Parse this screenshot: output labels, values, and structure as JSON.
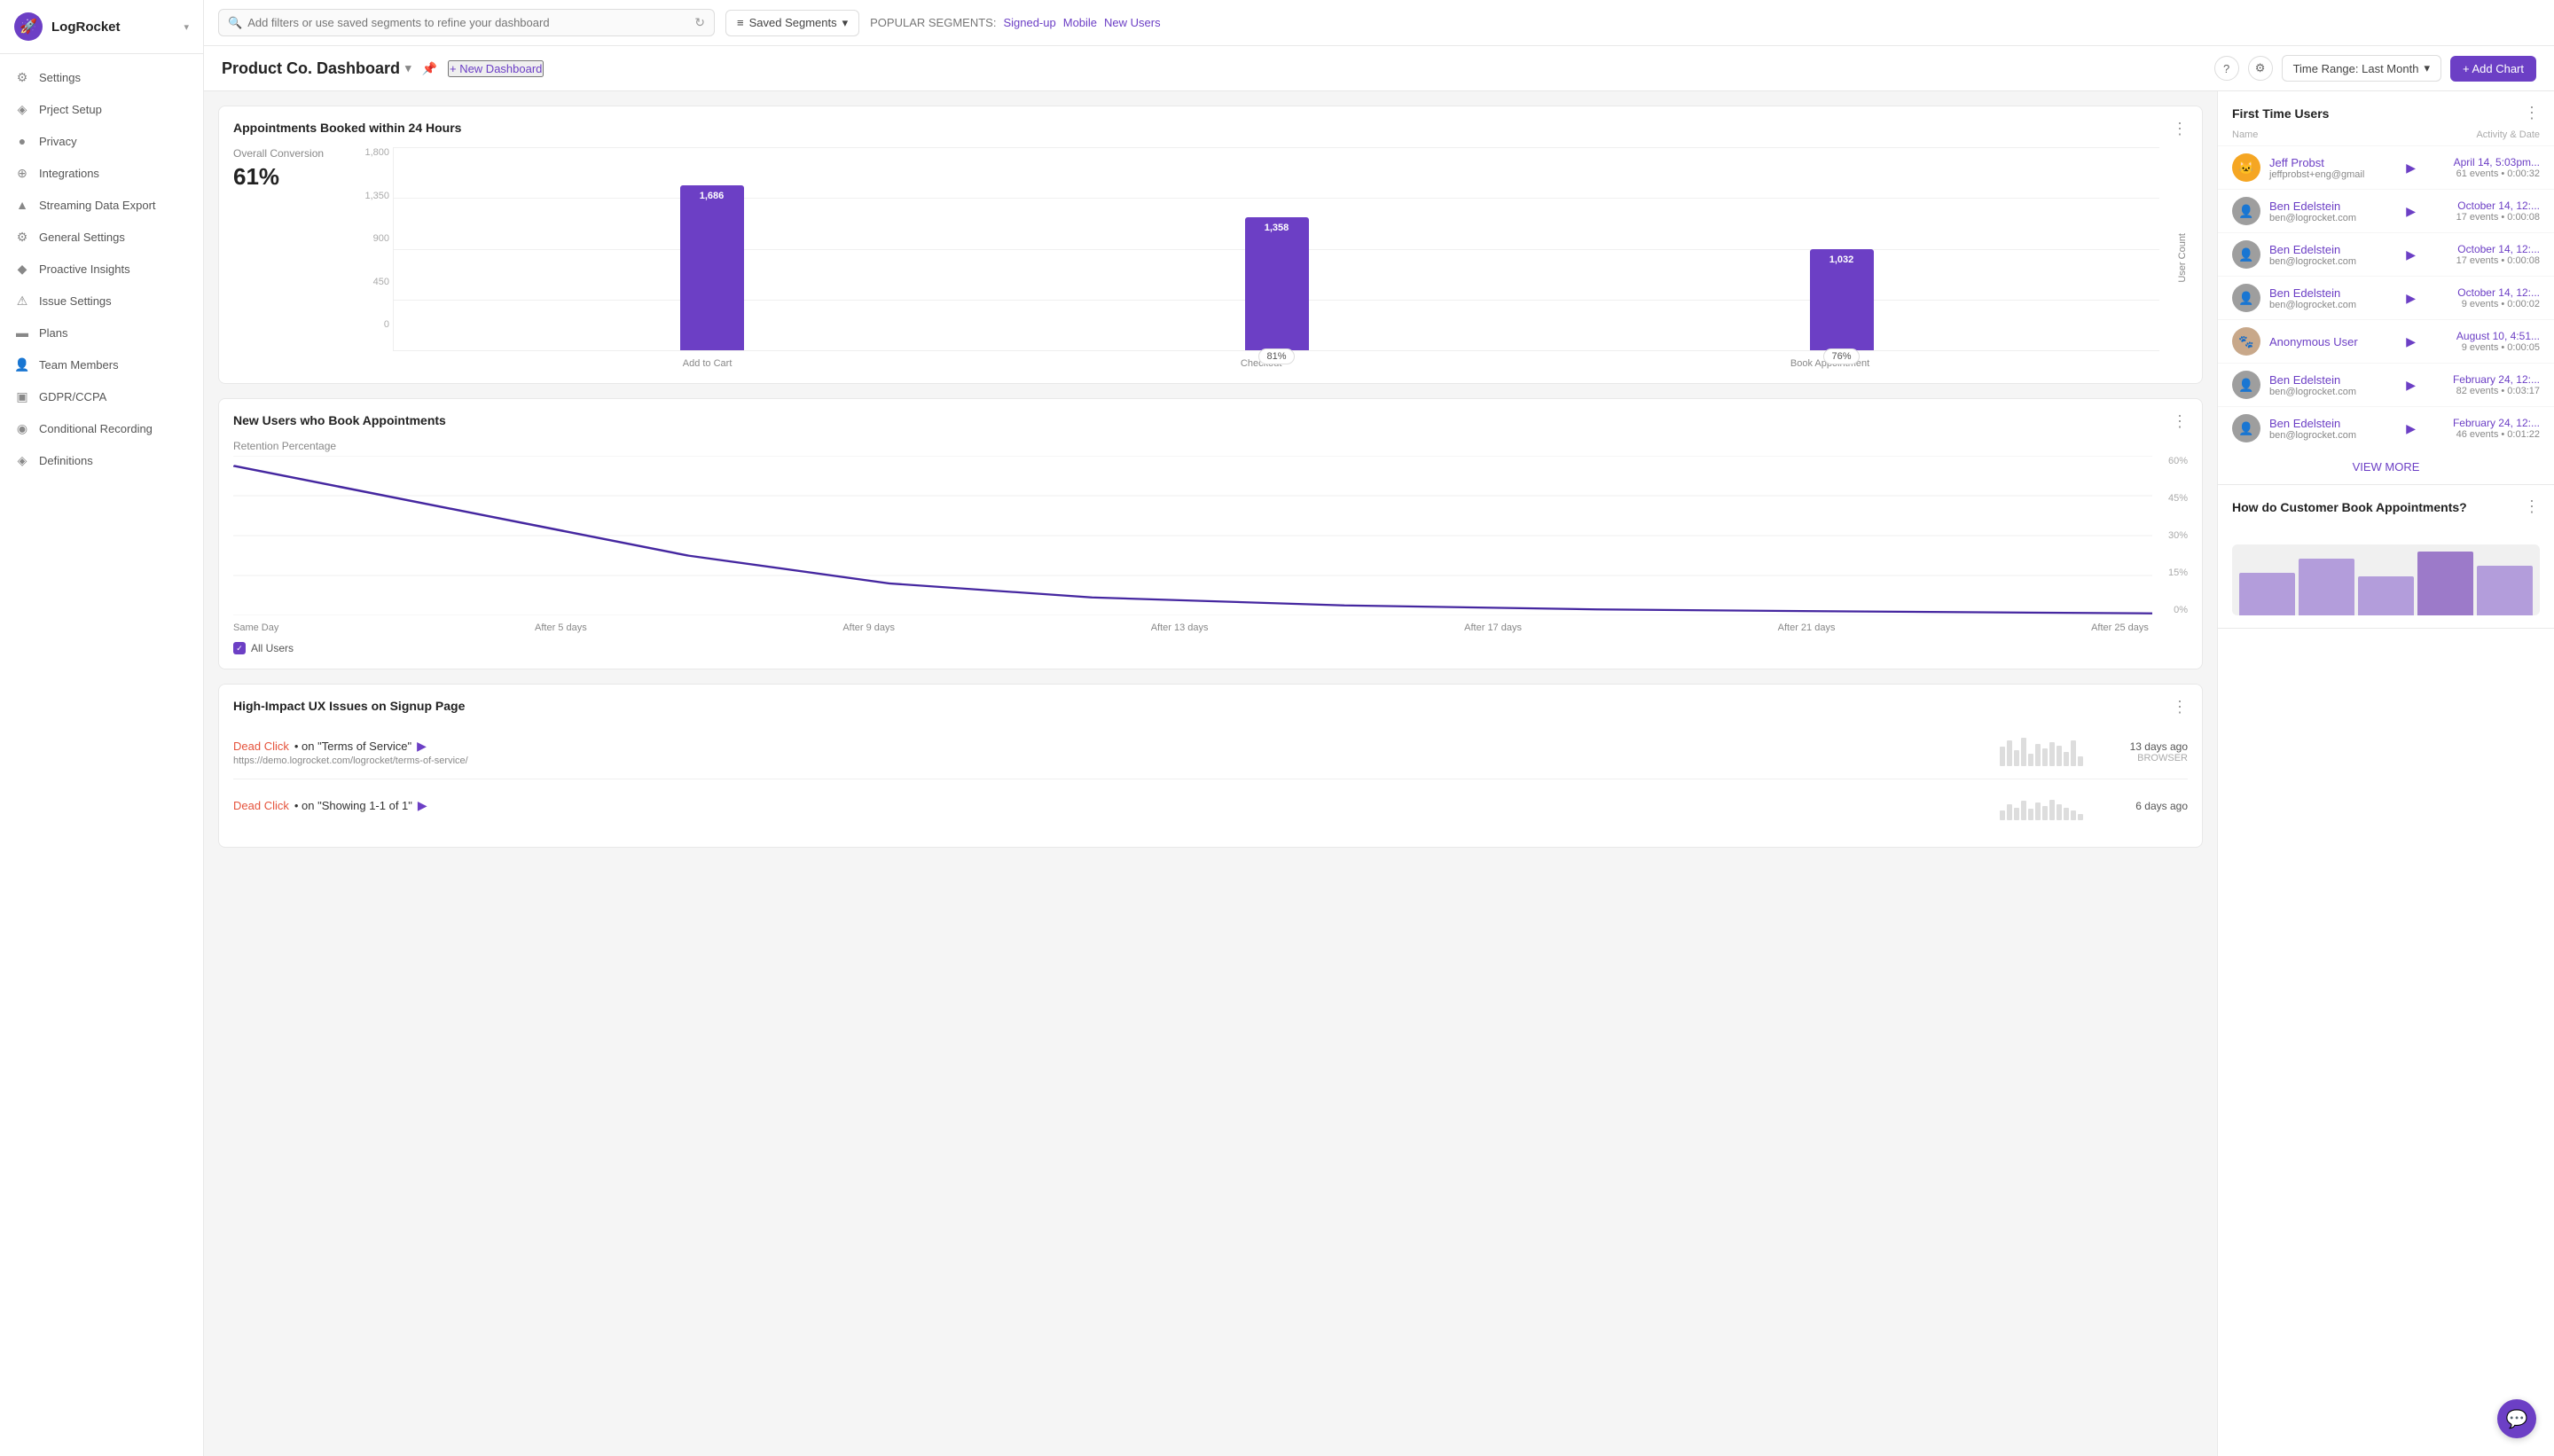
{
  "app": {
    "name": "LogRocket",
    "logo_symbol": "🚀"
  },
  "sidebar": {
    "items": [
      {
        "id": "settings",
        "label": "Settings",
        "icon": "⚙"
      },
      {
        "id": "project-setup",
        "label": "Prject Setup",
        "icon": "◈"
      },
      {
        "id": "privacy",
        "label": "Privacy",
        "icon": "●"
      },
      {
        "id": "integrations",
        "label": "Integrations",
        "icon": "⊕"
      },
      {
        "id": "streaming-data-export",
        "label": "Streaming Data Export",
        "icon": "▲"
      },
      {
        "id": "general-settings",
        "label": "General Settings",
        "icon": "⚙"
      },
      {
        "id": "proactive-insights",
        "label": "Proactive Insights",
        "icon": "◆"
      },
      {
        "id": "issue-settings",
        "label": "Issue Settings",
        "icon": "⚠"
      },
      {
        "id": "plans",
        "label": "Plans",
        "icon": "▬"
      },
      {
        "id": "team-members",
        "label": "Team Members",
        "icon": "👤"
      },
      {
        "id": "gdpr-ccpa",
        "label": "GDPR/CCPA",
        "icon": "▣"
      },
      {
        "id": "conditional-recording",
        "label": "Conditional Recording",
        "icon": "◉"
      },
      {
        "id": "definitions",
        "label": "Definitions",
        "icon": "◈"
      }
    ]
  },
  "topbar": {
    "search_placeholder": "Add filters or use saved segments to refine your dashboard",
    "saved_segments_label": "Saved Segments",
    "popular_segments_label": "POPULAR SEGMENTS:",
    "popular_links": [
      "Signed-up",
      "Mobile",
      "New Users"
    ]
  },
  "dashboard_header": {
    "title": "Product Co. Dashboard",
    "new_dashboard_label": "+ New Dashboard",
    "time_range_label": "Time Range: Last Month",
    "add_chart_label": "+ Add Chart"
  },
  "funnel_chart": {
    "title": "Appointments Booked within 24 Hours",
    "conversion_label": "Overall Conversion",
    "conversion_value": "61%",
    "y_label": "User Count",
    "y_axis": [
      "1,800",
      "1,350",
      "900",
      "450",
      "0"
    ],
    "bars": [
      {
        "label": "Add to Cart",
        "value": "1,686",
        "height_pct": 93,
        "conversion": null
      },
      {
        "label": "Checkout",
        "value": "1,358",
        "height_pct": 75,
        "conversion": "81%"
      },
      {
        "label": "Book Appointment",
        "value": "1,032",
        "height_pct": 57,
        "conversion": "76%"
      }
    ]
  },
  "retention_chart": {
    "title": "New Users who Book Appointments",
    "y_label": "Retention Percentage",
    "y_axis_right": [
      "60%",
      "45%",
      "30%",
      "15%",
      "0%"
    ],
    "x_axis": [
      "Same Day",
      "After 5 days",
      "After 9 days",
      "After 13 days",
      "After 17 days",
      "After 21 days",
      "After 25 days"
    ],
    "all_users_label": "All Users"
  },
  "issues_card": {
    "title": "High-Impact UX Issues on Signup Page",
    "issues": [
      {
        "type": "Dead Click",
        "on": "on \"Terms of Service\"",
        "url": "https://demo.logrocket.com/logrocket/terms-of-service/",
        "time_ago": "13 days ago",
        "source": "BROWSER"
      },
      {
        "type": "Dead Click",
        "on": "on \"Showing 1-1 of 1\"",
        "url": "",
        "time_ago": "6 days ago",
        "source": ""
      }
    ]
  },
  "right_panel": {
    "first_time_users": {
      "title": "First Time Users",
      "col_name": "Name",
      "col_activity": "Activity & Date",
      "users": [
        {
          "name": "Jeff Probst",
          "email": "jeffprobst+eng@gmail",
          "date": "April 14, 5:03pm...",
          "events": "61 events",
          "duration": "0:00:32",
          "avatar_emoji": "🐱"
        },
        {
          "name": "Ben Edelstein",
          "email": "ben@logrocket.com",
          "date": "October 14, 12:...",
          "events": "17 events",
          "duration": "0:00:08",
          "avatar_emoji": "👤"
        },
        {
          "name": "Ben Edelstein",
          "email": "ben@logrocket.com",
          "date": "October 14, 12:...",
          "events": "17 events",
          "duration": "0:00:08",
          "avatar_emoji": "👤"
        },
        {
          "name": "Ben Edelstein",
          "email": "ben@logrocket.com",
          "date": "October 14, 12:...",
          "events": "9 events",
          "duration": "0:00:02",
          "avatar_emoji": "👤"
        },
        {
          "name": "Anonymous User",
          "email": "",
          "date": "August 10, 4:51...",
          "events": "9 events",
          "duration": "0:00:05",
          "avatar_emoji": "🐾"
        },
        {
          "name": "Ben Edelstein",
          "email": "ben@logrocket.com",
          "date": "February 24, 12:...",
          "events": "82 events",
          "duration": "0:03:17",
          "avatar_emoji": "👤"
        },
        {
          "name": "Ben Edelstein",
          "email": "ben@logrocket.com",
          "date": "February 24, 12:...",
          "events": "46 events",
          "duration": "0:01:22",
          "avatar_emoji": "👤"
        }
      ],
      "view_more_label": "VIEW MORE"
    },
    "book_appointments": {
      "title": "How do Customer Book Appointments?"
    }
  }
}
